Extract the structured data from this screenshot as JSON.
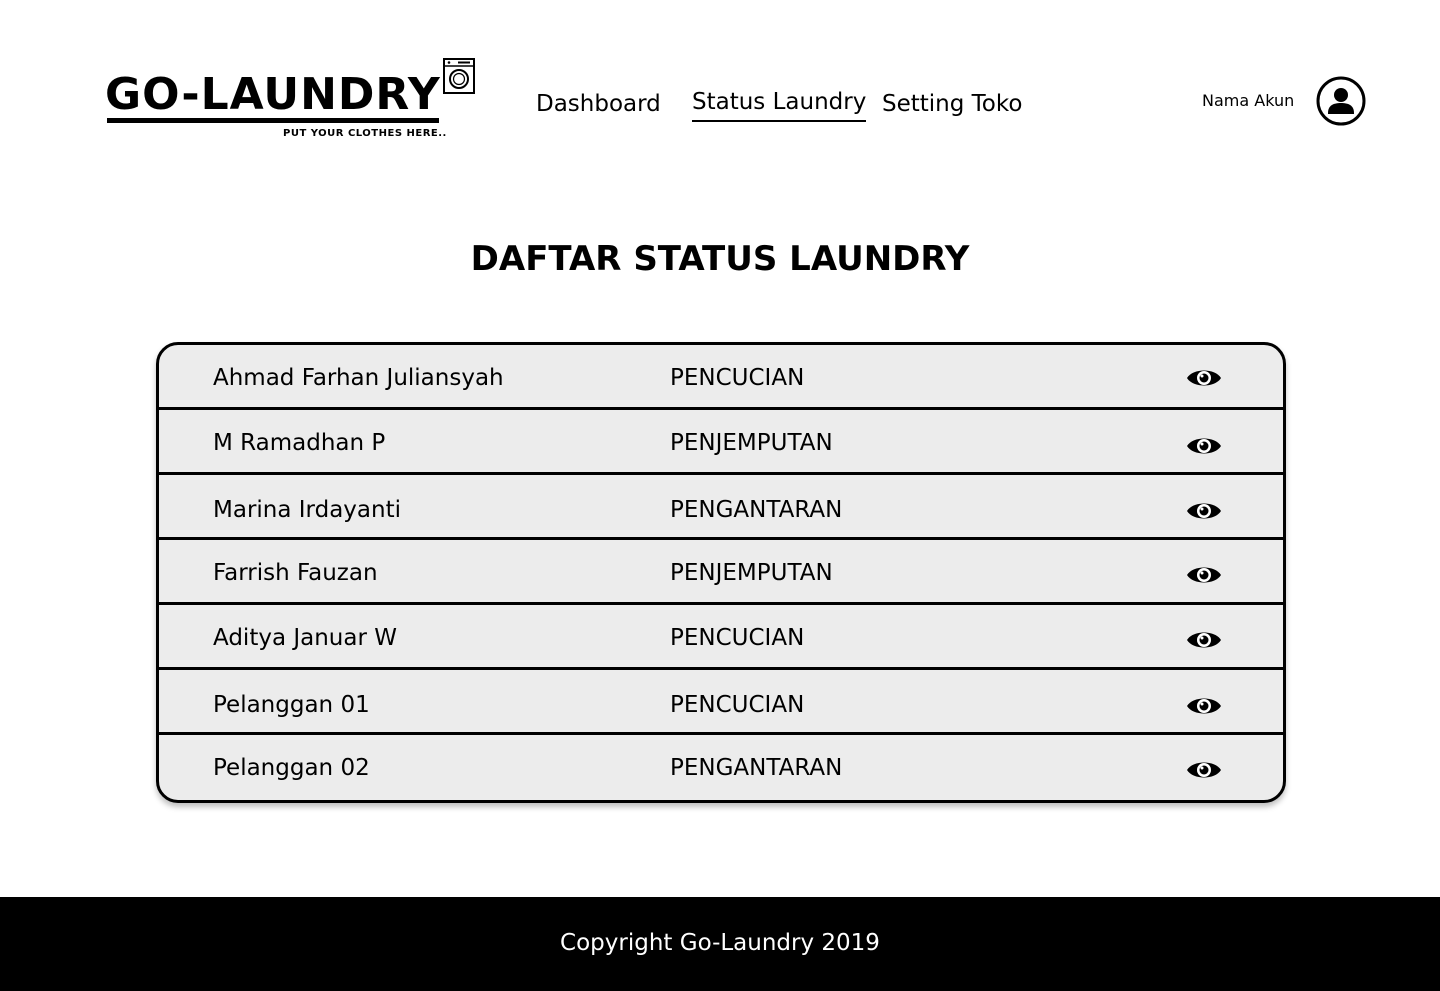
{
  "brand": {
    "name": "GO-LAUNDRY",
    "tagline": "PUT YOUR CLOTHES HERE.."
  },
  "nav": {
    "items": [
      {
        "label": "Dashboard"
      },
      {
        "label": "Status Laundry",
        "active": true
      },
      {
        "label": "Setting Toko"
      }
    ]
  },
  "account": {
    "name": "Nama Akun",
    "icon": "user-avatar-icon"
  },
  "main": {
    "title": "DAFTAR STATUS LAUNDRY",
    "rows": [
      {
        "name": "Ahmad Farhan Juliansyah",
        "status": "PENCUCIAN",
        "action_icon": "eye-icon"
      },
      {
        "name": "M Ramadhan P",
        "status": "PENJEMPUTAN",
        "action_icon": "eye-icon"
      },
      {
        "name": "Marina Irdayanti",
        "status": "PENGANTARAN",
        "action_icon": "eye-icon"
      },
      {
        "name": "Farrish Fauzan",
        "status": "PENJEMPUTAN",
        "action_icon": "eye-icon"
      },
      {
        "name": "Aditya Januar W",
        "status": "PENCUCIAN",
        "action_icon": "eye-icon"
      },
      {
        "name": "Pelanggan 01",
        "status": "PENCUCIAN",
        "action_icon": "eye-icon"
      },
      {
        "name": "Pelanggan 02",
        "status": "PENGANTARAN",
        "action_icon": "eye-icon"
      }
    ]
  },
  "footer": {
    "text": "Copyright Go-Laundry 2019"
  },
  "colors": {
    "table_background": "#ececec",
    "footer_background": "#000000",
    "footer_text": "#ffffff"
  }
}
